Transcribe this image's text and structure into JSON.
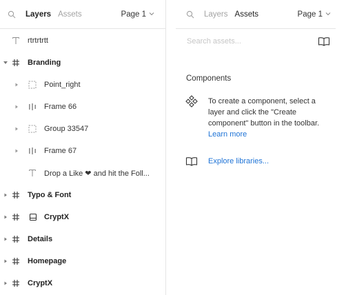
{
  "left_panel": {
    "tabs": [
      {
        "label": "Layers",
        "active": true
      },
      {
        "label": "Assets",
        "active": false
      }
    ],
    "page_selector": {
      "label": "Page 1"
    },
    "layers": [
      {
        "label": "rtrtrtrtt",
        "icon": "text-icon",
        "level": 0,
        "caret": "none",
        "bold": false
      },
      {
        "label": "Branding",
        "icon": "frame-hash-icon",
        "level": 0,
        "caret": "down",
        "bold": true
      },
      {
        "label": "Point_right",
        "icon": "group-dashed-icon",
        "level": 1,
        "caret": "right",
        "bold": false
      },
      {
        "label": "Frame 66",
        "icon": "auto-layout-icon",
        "level": 1,
        "caret": "right",
        "bold": false
      },
      {
        "label": "Group 33547",
        "icon": "group-dashed-icon",
        "level": 1,
        "caret": "right",
        "bold": false
      },
      {
        "label": "Frame 67",
        "icon": "auto-layout-icon",
        "level": 1,
        "caret": "right",
        "bold": false
      },
      {
        "label": "Drop a Like ❤ and hit the Foll...",
        "icon": "text-icon",
        "level": 1,
        "caret": "none",
        "bold": false
      },
      {
        "label": "Typo & Font",
        "icon": "frame-hash-icon",
        "level": 0,
        "caret": "right",
        "bold": true
      },
      {
        "label": "CryptX",
        "icon": "frame-hash-icon",
        "level": 0,
        "caret": "right",
        "bold": true,
        "extra_icon": "component-frame-icon"
      },
      {
        "label": "Details",
        "icon": "frame-hash-icon",
        "level": 0,
        "caret": "right",
        "bold": true
      },
      {
        "label": "Homepage",
        "icon": "frame-hash-icon",
        "level": 0,
        "caret": "right",
        "bold": true
      },
      {
        "label": "CryptX",
        "icon": "frame-hash-icon",
        "level": 0,
        "caret": "right",
        "bold": true
      }
    ]
  },
  "right_panel": {
    "tabs": [
      {
        "label": "Layers",
        "active": false
      },
      {
        "label": "Assets",
        "active": true
      }
    ],
    "page_selector": {
      "label": "Page 1"
    },
    "search": {
      "placeholder": "Search assets..."
    },
    "components": {
      "title": "Components",
      "empty_text": "To create a component, select a layer and click the \"Create component\" button in the toolbar.",
      "learn_more": "Learn more"
    },
    "explore": {
      "label": "Explore libraries..."
    }
  },
  "colors": {
    "link": "#1e73d6",
    "divider": "#e5e5e5",
    "muted_text": "#a3a3a3",
    "placeholder": "#c6c6c6"
  }
}
